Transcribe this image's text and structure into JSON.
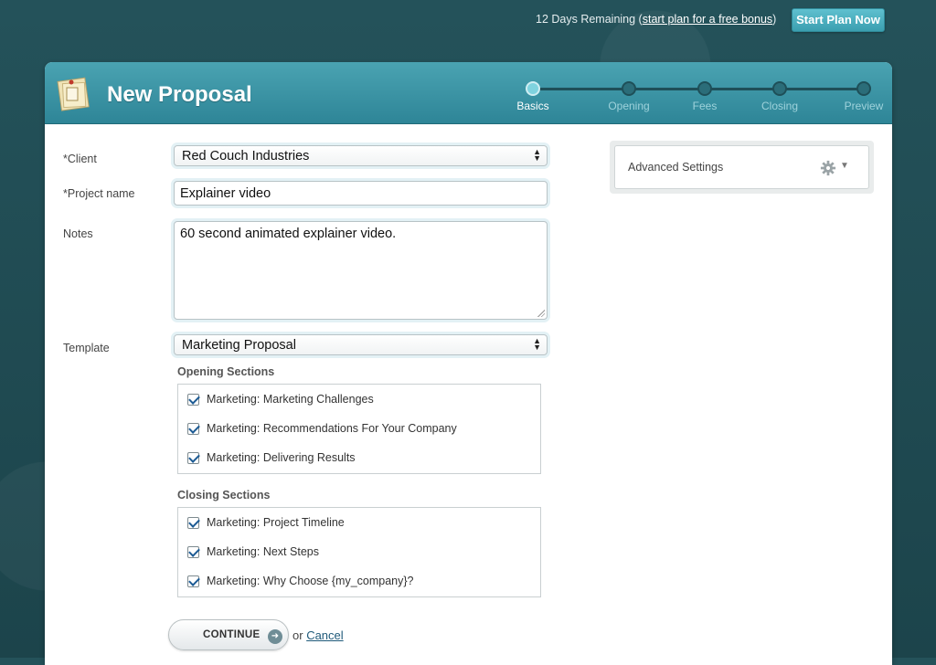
{
  "topbar": {
    "trial_prefix": "12 Days Remaining (",
    "trial_link": "start plan for a free bonus",
    "trial_suffix": ")",
    "start_plan_label": "Start Plan Now"
  },
  "header": {
    "title": "New Proposal",
    "steps": [
      {
        "label": "Basics",
        "active": true
      },
      {
        "label": "Opening",
        "active": false
      },
      {
        "label": "Fees",
        "active": false
      },
      {
        "label": "Closing",
        "active": false
      },
      {
        "label": "Preview",
        "active": false
      }
    ]
  },
  "form": {
    "client_label": "*Client",
    "client_value": "Red Couch Industries",
    "project_label": "*Project name",
    "project_value": "Explainer video",
    "notes_label": "Notes",
    "notes_value": "60 second animated explainer video.",
    "template_label": "Template",
    "template_value": "Marketing Proposal"
  },
  "opening_sections": {
    "title": "Opening Sections",
    "items": [
      "Marketing: Marketing Challenges",
      "Marketing: Recommendations For Your Company",
      "Marketing: Delivering Results"
    ]
  },
  "closing_sections": {
    "title": "Closing Sections",
    "items": [
      "Marketing: Project Timeline",
      "Marketing: Next Steps",
      "Marketing: Why Choose {my_company}?"
    ]
  },
  "actions": {
    "continue_label": "CONTINUE",
    "or_text": "or",
    "cancel_label": "Cancel"
  },
  "advanced": {
    "label": "Advanced Settings"
  },
  "icons": {
    "document": "document-icon",
    "gear": "gear-icon",
    "continue_arrow": "arrow-right-icon",
    "select_arrows": "select-arrows-icon"
  }
}
